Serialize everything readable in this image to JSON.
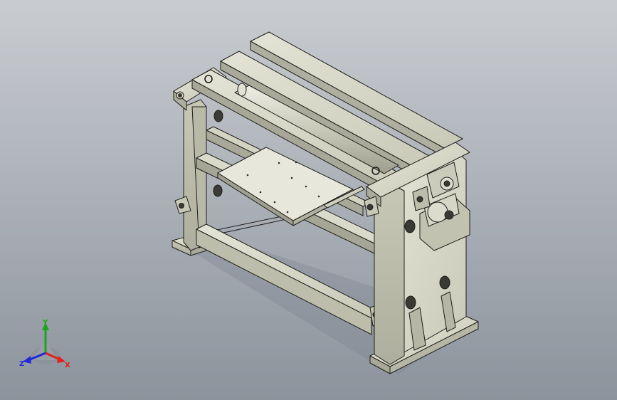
{
  "triad": {
    "x_label": "X",
    "y_label": "Y",
    "z_label": "Z",
    "colors": {
      "x": "#e0201c",
      "y": "#1aa51a",
      "z": "#1f2ad8"
    }
  },
  "model": {
    "icon": "sheet-roller-machine-3d-model",
    "colors": {
      "light": "#d8d8c8",
      "mid": "#c4c4b2",
      "dark": "#a7a797",
      "edge": "#1e1e1a",
      "shadow": "#7c7f85",
      "plate": "#e6e6da"
    }
  }
}
